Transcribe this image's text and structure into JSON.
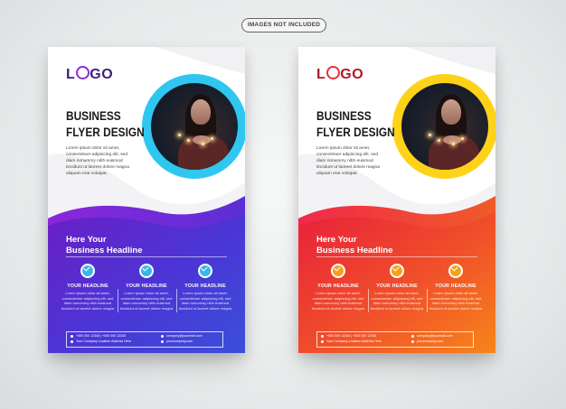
{
  "badge": "IMAGES NOT INCLUDED",
  "flyers": [
    {
      "logo_prefix": "L",
      "logo_suffix": "GO",
      "title_line1": "BUSINESS",
      "title_line2": "FLYER DESIGN",
      "body_text": "Lorem ipsum dolor sit amet, consectetuer adipiscing elit, sed diam nonummy nibh euismod tincidunt ut laoreet dolore magna aliquam erat volutpat.",
      "headline_line1": "Here Your",
      "headline_line2": "Business Headline",
      "columns": [
        {
          "heading": "YOUR HEADLINE",
          "text": "Lorem ipsum dolor sit amet, consectetuer adipiscing elit, sed diam nonummy nibh euismod tincidunt ut laoreet dolore magna"
        },
        {
          "heading": "YOUR HEADLINE",
          "text": "Lorem ipsum dolor sit amet, consectetuer adipiscing elit, sed diam nonummy nibh euismod tincidunt ut laoreet dolore magna"
        },
        {
          "heading": "YOUR HEADLINE",
          "text": "Lorem ipsum dolor sit amet, consectetuer adipiscing elit, sed diam nonummy nibh euismod tincidunt ut laoreet dolore magna"
        }
      ],
      "footer_phone": "+000 000 12345  |  +000 000 12345",
      "footer_address": "Your Company Location Address Here",
      "footer_email": "company@yourmail.com",
      "footer_web": "yourcompany.com",
      "colors": {
        "accent1": "#2fc7f0",
        "accent2": "#7b22d6",
        "accent3": "#3b4fd8",
        "icon": "#39b7e8"
      }
    },
    {
      "logo_prefix": "L",
      "logo_suffix": "GO",
      "title_line1": "BUSINESS",
      "title_line2": "FLYER DESIGN",
      "body_text": "Lorem ipsum dolor sit amet, consectetuer adipiscing elit, sed diam nonummy nibh euismod tincidunt ut laoreet dolore magna aliquam erat volutpat.",
      "headline_line1": "Here Your",
      "headline_line2": "Business Headline",
      "columns": [
        {
          "heading": "YOUR HEADLINE",
          "text": "Lorem ipsum dolor sit amet, consectetuer adipiscing elit, sed diam nonummy nibh euismod tincidunt ut laoreet dolore magna"
        },
        {
          "heading": "YOUR HEADLINE",
          "text": "Lorem ipsum dolor sit amet, consectetuer adipiscing elit, sed diam nonummy nibh euismod tincidunt ut laoreet dolore magna"
        },
        {
          "heading": "YOUR HEADLINE",
          "text": "Lorem ipsum dolor sit amet, consectetuer adipiscing elit, sed diam nonummy nibh euismod tincidunt ut laoreet dolore magna"
        }
      ],
      "footer_phone": "+000 000 12345  |  +000 000 12345",
      "footer_address": "Your Company Location Address Here",
      "footer_email": "company@yourmail.com",
      "footer_web": "yourcompany.com",
      "colors": {
        "accent1": "#ffd21a",
        "accent2": "#e8203a",
        "accent3": "#f7801a",
        "icon": "#f3a21c"
      }
    }
  ]
}
